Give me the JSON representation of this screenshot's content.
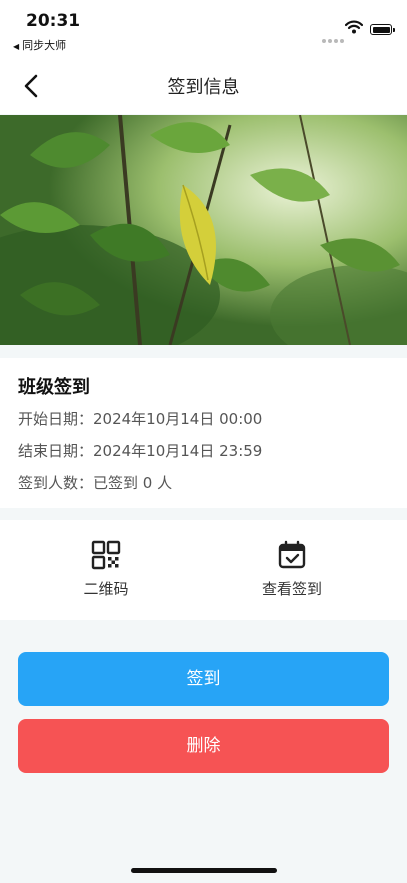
{
  "status_bar": {
    "time": "20:31",
    "back_app": "同步大师"
  },
  "nav": {
    "title": "签到信息"
  },
  "card": {
    "title": "班级签到",
    "start": "开始日期：2024年10月14日 00:00",
    "end": "结束日期：2024年10月14日 23:59",
    "count": "签到人数：已签到 0 人"
  },
  "actions": {
    "qr_label": "二维码",
    "view_label": "查看签到"
  },
  "buttons": {
    "signin": "签到",
    "delete": "删除"
  },
  "icons": {
    "back": "chevron-left-icon",
    "qr": "qrcode-icon",
    "calendar": "calendar-check-icon",
    "wifi": "wifi-icon",
    "battery": "battery-icon"
  },
  "colors": {
    "primary": "#27a4f6",
    "danger": "#f65354",
    "background": "#f3f7f8"
  }
}
